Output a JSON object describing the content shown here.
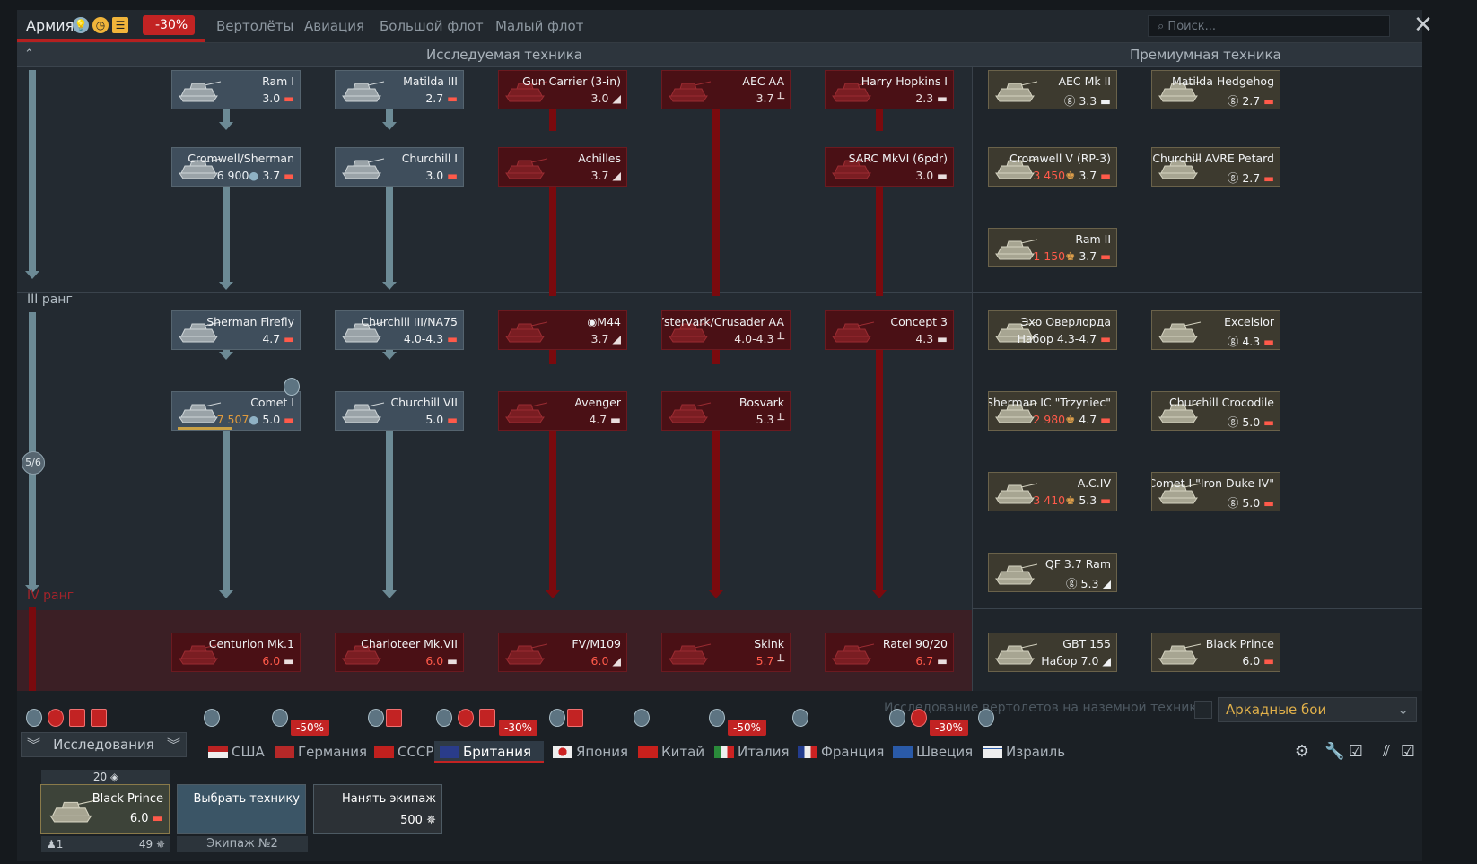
{
  "topbar": {
    "army": "Армия",
    "army_discount": "-30%",
    "tabs": [
      "Вертолёты",
      "Авиация",
      "Большой флот",
      "Малый флот"
    ],
    "search_placeholder": "Поиск...",
    "close": "✕"
  },
  "tree": {
    "researched_title": "Исследуемая техника",
    "premium_title": "Премиумная техника",
    "rank3_label": "III ранг",
    "rank4_label": "IV ранг",
    "rank_progress": "5/6"
  },
  "vehicles": {
    "ram1": {
      "name": "Ram I",
      "br": "3.0"
    },
    "matilda3": {
      "name": "Matilda III",
      "br": "2.7"
    },
    "gun_carrier": {
      "name": "Gun Carrier (3-in)",
      "br": "3.0"
    },
    "aec_aa": {
      "name": "AEC AA",
      "br": "3.7"
    },
    "harry_hopkins": {
      "name": "Harry Hopkins I",
      "br": "2.3"
    },
    "cromwell_sherman": {
      "name": "Cromwell/Sherman",
      "cost": "6 900",
      "br": "3.7"
    },
    "churchill1": {
      "name": "Churchill I",
      "br": "3.0"
    },
    "achilles": {
      "name": "Achilles",
      "br": "3.7"
    },
    "sarc": {
      "name": "SARC MkVI (6pdr)",
      "br": "3.0"
    },
    "firefly": {
      "name": "Sherman Firefly",
      "br": "4.7"
    },
    "churchill3": {
      "name": "Churchill III/NA75",
      "br": "4.0-4.3"
    },
    "m44": {
      "name": "M44",
      "br": "3.7"
    },
    "ystervark": {
      "name": "Ystervark/Crusader AA",
      "br": "4.0-4.3"
    },
    "concept3": {
      "name": "Concept 3",
      "br": "4.3"
    },
    "comet": {
      "name": "Comet I",
      "cost": "7 507",
      "br": "5.0"
    },
    "churchill7": {
      "name": "Churchill VII",
      "br": "5.0"
    },
    "avenger": {
      "name": "Avenger",
      "br": "4.7"
    },
    "bosvark": {
      "name": "Bosvark",
      "br": "5.3"
    },
    "centurion": {
      "name": "Centurion Mk.1",
      "br": "6.0"
    },
    "charioteer": {
      "name": "Charioteer Mk.VII",
      "br": "6.0"
    },
    "fv109": {
      "name": "FV/M109",
      "br": "6.0"
    },
    "skink": {
      "name": "Skink",
      "br": "5.7"
    },
    "ratel": {
      "name": "Ratel 90/20",
      "br": "6.7"
    }
  },
  "premium": {
    "aec2": {
      "name": "AEC Mk II",
      "br": "3.3"
    },
    "hedgehog": {
      "name": "Matilda Hedgehog",
      "br": "2.7"
    },
    "cromwell5": {
      "name": "Cromwell V (RP-3)",
      "cost": "3 450",
      "br": "3.7"
    },
    "petard": {
      "name": "Churchill AVRE Petard",
      "br": "2.7"
    },
    "ram2": {
      "name": "Ram II",
      "cost": "1 150",
      "br": "3.7"
    },
    "overlord": {
      "name": "Эхо Оверлорда",
      "br": "Набор 4.3-4.7"
    },
    "excelsior": {
      "name": "Excelsior",
      "br": "4.3"
    },
    "trzyniec": {
      "name": "Sherman IC \"Trzyniec\"",
      "cost": "2 980",
      "br": "4.7"
    },
    "crocodile": {
      "name": "Churchill Crocodile",
      "br": "5.0"
    },
    "aciv": {
      "name": "A.C.IV",
      "cost": "3 410",
      "br": "5.3"
    },
    "ironduke": {
      "name": "Comet I \"Iron Duke IV\"",
      "br": "5.0"
    },
    "qf37": {
      "name": "QF 3.7 Ram",
      "br": "5.3"
    },
    "gbt155": {
      "name": "GBT 155",
      "br": "Набор 7.0"
    },
    "blackprince": {
      "name": "Black Prince",
      "br": "6.0"
    }
  },
  "bottom": {
    "heli_research": "Исследование вертолетов на наземной технике",
    "game_mode": "Аркадные бои",
    "research": "Исследования",
    "discounts": {
      "germany": "-50%",
      "britain": "-30%",
      "italy": "-50%",
      "sweden": "-30%"
    },
    "nations": [
      "США",
      "Германия",
      "СССР",
      "Британия",
      "Япония",
      "Китай",
      "Италия",
      "Франция",
      "Швеция",
      "Израиль"
    ],
    "crew": {
      "count": "20",
      "vehicle": "Black Prince",
      "br": "6.0",
      "crew_num": "1",
      "level": "49",
      "choose": "Выбрать технику",
      "hire": "Нанять экипаж",
      "hire_cost": "500",
      "crew_label": "Экипаж №2"
    }
  },
  "colors": {
    "accent_red": "#c22323",
    "researched": "#3f4e5c",
    "locked": "#4a1015",
    "premium": "#3d3a2f",
    "gold": "#e3a24b"
  }
}
